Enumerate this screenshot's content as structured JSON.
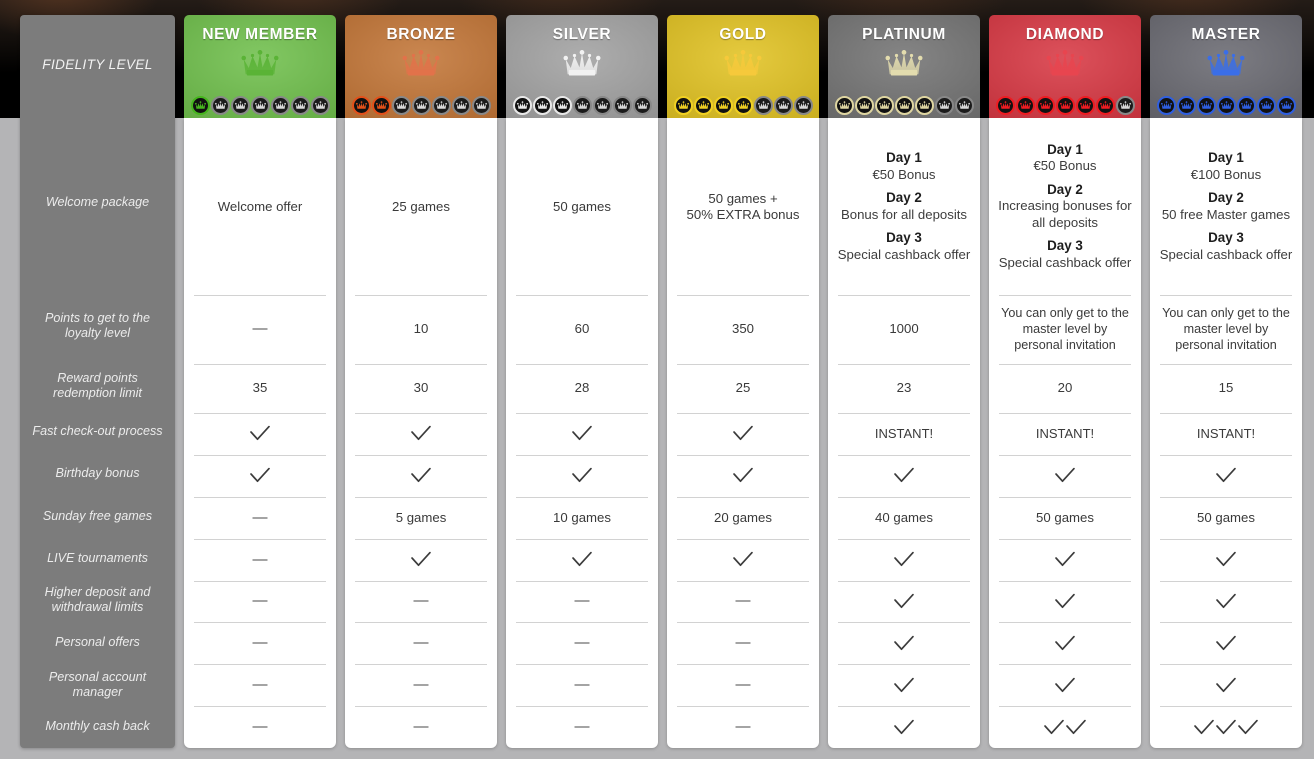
{
  "header_label": "FIDELITY LEVEL",
  "row_labels": [
    "Welcome package",
    "Points to get to the loyalty level",
    "Reward points redemption limit",
    "Fast check-out process",
    "Birthday bonus",
    "Sunday free games",
    "LIVE tournaments",
    "Higher deposit and withdrawal limits",
    "Personal offers",
    "Personal account manager",
    "Monthly cash back"
  ],
  "tiers": [
    {
      "name": "NEW MEMBER",
      "color": "#6abd45",
      "crown_color": "#5ab336",
      "pip_color": "#46b51e",
      "pips_filled": 1,
      "pips_total": 7,
      "welcome_package": {
        "type": "text",
        "text": "Welcome offer"
      },
      "points_to_level": "—",
      "reward_points_limit": "35",
      "fast_checkout": {
        "type": "check",
        "count": 1
      },
      "birthday_bonus": {
        "type": "check",
        "count": 1
      },
      "sunday_free_games": {
        "type": "text",
        "text": "—"
      },
      "live_tournaments": {
        "type": "text",
        "text": "—"
      },
      "higher_limits": {
        "type": "text",
        "text": "—"
      },
      "personal_offers": {
        "type": "text",
        "text": "—"
      },
      "account_manager": {
        "type": "text",
        "text": "—"
      },
      "monthly_cash_back": {
        "type": "text",
        "text": "—"
      }
    },
    {
      "name": "BRONZE",
      "color": "#c0702f",
      "crown_color": "#e2724a",
      "pip_color": "#e2501a",
      "pips_filled": 2,
      "pips_total": 7,
      "welcome_package": {
        "type": "text",
        "text": "25 games"
      },
      "points_to_level": "10",
      "reward_points_limit": "30",
      "fast_checkout": {
        "type": "check",
        "count": 1
      },
      "birthday_bonus": {
        "type": "check",
        "count": 1
      },
      "sunday_free_games": {
        "type": "text",
        "text": "5 games"
      },
      "live_tournaments": {
        "type": "check",
        "count": 1
      },
      "higher_limits": {
        "type": "text",
        "text": "—"
      },
      "personal_offers": {
        "type": "text",
        "text": "—"
      },
      "account_manager": {
        "type": "text",
        "text": "—"
      },
      "monthly_cash_back": {
        "type": "text",
        "text": "—"
      }
    },
    {
      "name": "SILVER",
      "color": "#9e9e9e",
      "crown_color": "#f2f2f2",
      "pip_color": "#e8e8e8",
      "pips_filled": 3,
      "pips_total": 7,
      "welcome_package": {
        "type": "text",
        "text": "50 games"
      },
      "points_to_level": "60",
      "reward_points_limit": "28",
      "fast_checkout": {
        "type": "check",
        "count": 1
      },
      "birthday_bonus": {
        "type": "check",
        "count": 1
      },
      "sunday_free_games": {
        "type": "text",
        "text": "10 games"
      },
      "live_tournaments": {
        "type": "check",
        "count": 1
      },
      "higher_limits": {
        "type": "text",
        "text": "—"
      },
      "personal_offers": {
        "type": "text",
        "text": "—"
      },
      "account_manager": {
        "type": "text",
        "text": "—"
      },
      "monthly_cash_back": {
        "type": "text",
        "text": "—"
      }
    },
    {
      "name": "GOLD",
      "color": "#e0c01a",
      "crown_color": "#f6c93b",
      "pip_color": "#f0d023",
      "pips_filled": 4,
      "pips_total": 7,
      "welcome_package": {
        "type": "text",
        "text": "50 games +\n50% EXTRA bonus"
      },
      "points_to_level": "350",
      "reward_points_limit": "25",
      "fast_checkout": {
        "type": "check",
        "count": 1
      },
      "birthday_bonus": {
        "type": "check",
        "count": 1
      },
      "sunday_free_games": {
        "type": "text",
        "text": "20 games"
      },
      "live_tournaments": {
        "type": "check",
        "count": 1
      },
      "higher_limits": {
        "type": "text",
        "text": "—"
      },
      "personal_offers": {
        "type": "text",
        "text": "—"
      },
      "account_manager": {
        "type": "text",
        "text": "—"
      },
      "monthly_cash_back": {
        "type": "text",
        "text": "—"
      }
    },
    {
      "name": "PLATINUM",
      "color": "#6e6e6e",
      "crown_color": "#e3dcae",
      "pip_color": "#ded5a1",
      "pips_filled": 5,
      "pips_total": 7,
      "welcome_package": {
        "type": "days",
        "days": [
          {
            "label": "Day 1",
            "text": "€50 Bonus"
          },
          {
            "label": "Day 2",
            "text": "Bonus for all deposits"
          },
          {
            "label": "Day 3",
            "text": "Special cashback offer"
          }
        ]
      },
      "points_to_level": "1000",
      "reward_points_limit": "23",
      "fast_checkout": {
        "type": "text",
        "text": "INSTANT!"
      },
      "birthday_bonus": {
        "type": "check",
        "count": 1
      },
      "sunday_free_games": {
        "type": "text",
        "text": "40 games"
      },
      "live_tournaments": {
        "type": "check",
        "count": 1
      },
      "higher_limits": {
        "type": "check",
        "count": 1
      },
      "personal_offers": {
        "type": "check",
        "count": 1
      },
      "account_manager": {
        "type": "check",
        "count": 1
      },
      "monthly_cash_back": {
        "type": "check",
        "count": 1
      }
    },
    {
      "name": "DIAMOND",
      "color": "#d6303c",
      "crown_color": "#e8454f",
      "pip_color": "#ee1c22",
      "pips_filled": 6,
      "pips_total": 7,
      "welcome_package": {
        "type": "days",
        "days": [
          {
            "label": "Day 1",
            "text": "€50 Bonus"
          },
          {
            "label": "Day 2",
            "text": "Increasing bonuses for all deposits"
          },
          {
            "label": "Day 3",
            "text": "Special cashback offer"
          }
        ]
      },
      "points_to_level": "You can only get to the master level by personal invitation",
      "reward_points_limit": "20",
      "fast_checkout": {
        "type": "text",
        "text": "INSTANT!"
      },
      "birthday_bonus": {
        "type": "check",
        "count": 1
      },
      "sunday_free_games": {
        "type": "text",
        "text": "50 games"
      },
      "live_tournaments": {
        "type": "check",
        "count": 1
      },
      "higher_limits": {
        "type": "check",
        "count": 1
      },
      "personal_offers": {
        "type": "check",
        "count": 1
      },
      "account_manager": {
        "type": "check",
        "count": 1
      },
      "monthly_cash_back": {
        "type": "check",
        "count": 2
      }
    },
    {
      "name": "MASTER",
      "color": "#63636b",
      "crown_color": "#3a6ee8",
      "pip_color": "#2f5fe0",
      "pips_filled": 7,
      "pips_total": 7,
      "welcome_package": {
        "type": "days",
        "days": [
          {
            "label": "Day 1",
            "text": "€100 Bonus"
          },
          {
            "label": "Day 2",
            "text": "50 free Master games"
          },
          {
            "label": "Day 3",
            "text": "Special cashback offer"
          }
        ]
      },
      "points_to_level": "You can only get to the master level by personal invitation",
      "reward_points_limit": "15",
      "fast_checkout": {
        "type": "text",
        "text": "INSTANT!"
      },
      "birthday_bonus": {
        "type": "check",
        "count": 1
      },
      "sunday_free_games": {
        "type": "text",
        "text": "50 games"
      },
      "live_tournaments": {
        "type": "check",
        "count": 1
      },
      "higher_limits": {
        "type": "check",
        "count": 1
      },
      "personal_offers": {
        "type": "check",
        "count": 1
      },
      "account_manager": {
        "type": "check",
        "count": 1
      },
      "monthly_cash_back": {
        "type": "check",
        "count": 3
      }
    }
  ]
}
